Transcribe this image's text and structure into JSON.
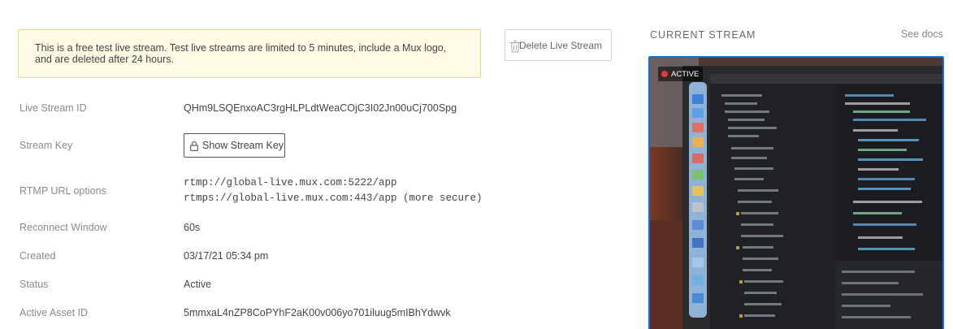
{
  "notice": {
    "text": "This is a free test live stream. Test live streams are limited to 5 minutes, include a Mux logo, and are deleted after 24 hours."
  },
  "delete_button": {
    "label": "Delete Live Stream"
  },
  "details": {
    "live_stream_id": {
      "label": "Live Stream ID",
      "value": "QHm9LSQEnxoAC3rgHLPLdtWeaCOjC3I02Jn00uCj700Spg"
    },
    "stream_key": {
      "label": "Stream Key",
      "button_label": "Show Stream Key"
    },
    "rtmp": {
      "label": "RTMP URL options",
      "url1": "rtmp://global-live.mux.com:5222/app",
      "url2": "rtmps://global-live.mux.com:443/app (more secure)"
    },
    "reconnect": {
      "label": "Reconnect Window",
      "value": "60s"
    },
    "created": {
      "label": "Created",
      "value": "03/17/21 05:34 pm"
    },
    "status": {
      "label": "Status",
      "value": "Active"
    },
    "active_asset": {
      "label": "Active Asset ID",
      "value": "5mmxaL4nZP8CoPYhF2aK00v006yo701iluug5mIBhYdwvk"
    }
  },
  "current_stream": {
    "title": "CURRENT STREAM",
    "docs_link": "See docs",
    "badge": "ACTIVE"
  },
  "colors": {
    "accent": "#1a6fd6",
    "notice_bg": "#fffae5",
    "notice_border": "#e8d58a",
    "live_dot": "#e53935"
  }
}
